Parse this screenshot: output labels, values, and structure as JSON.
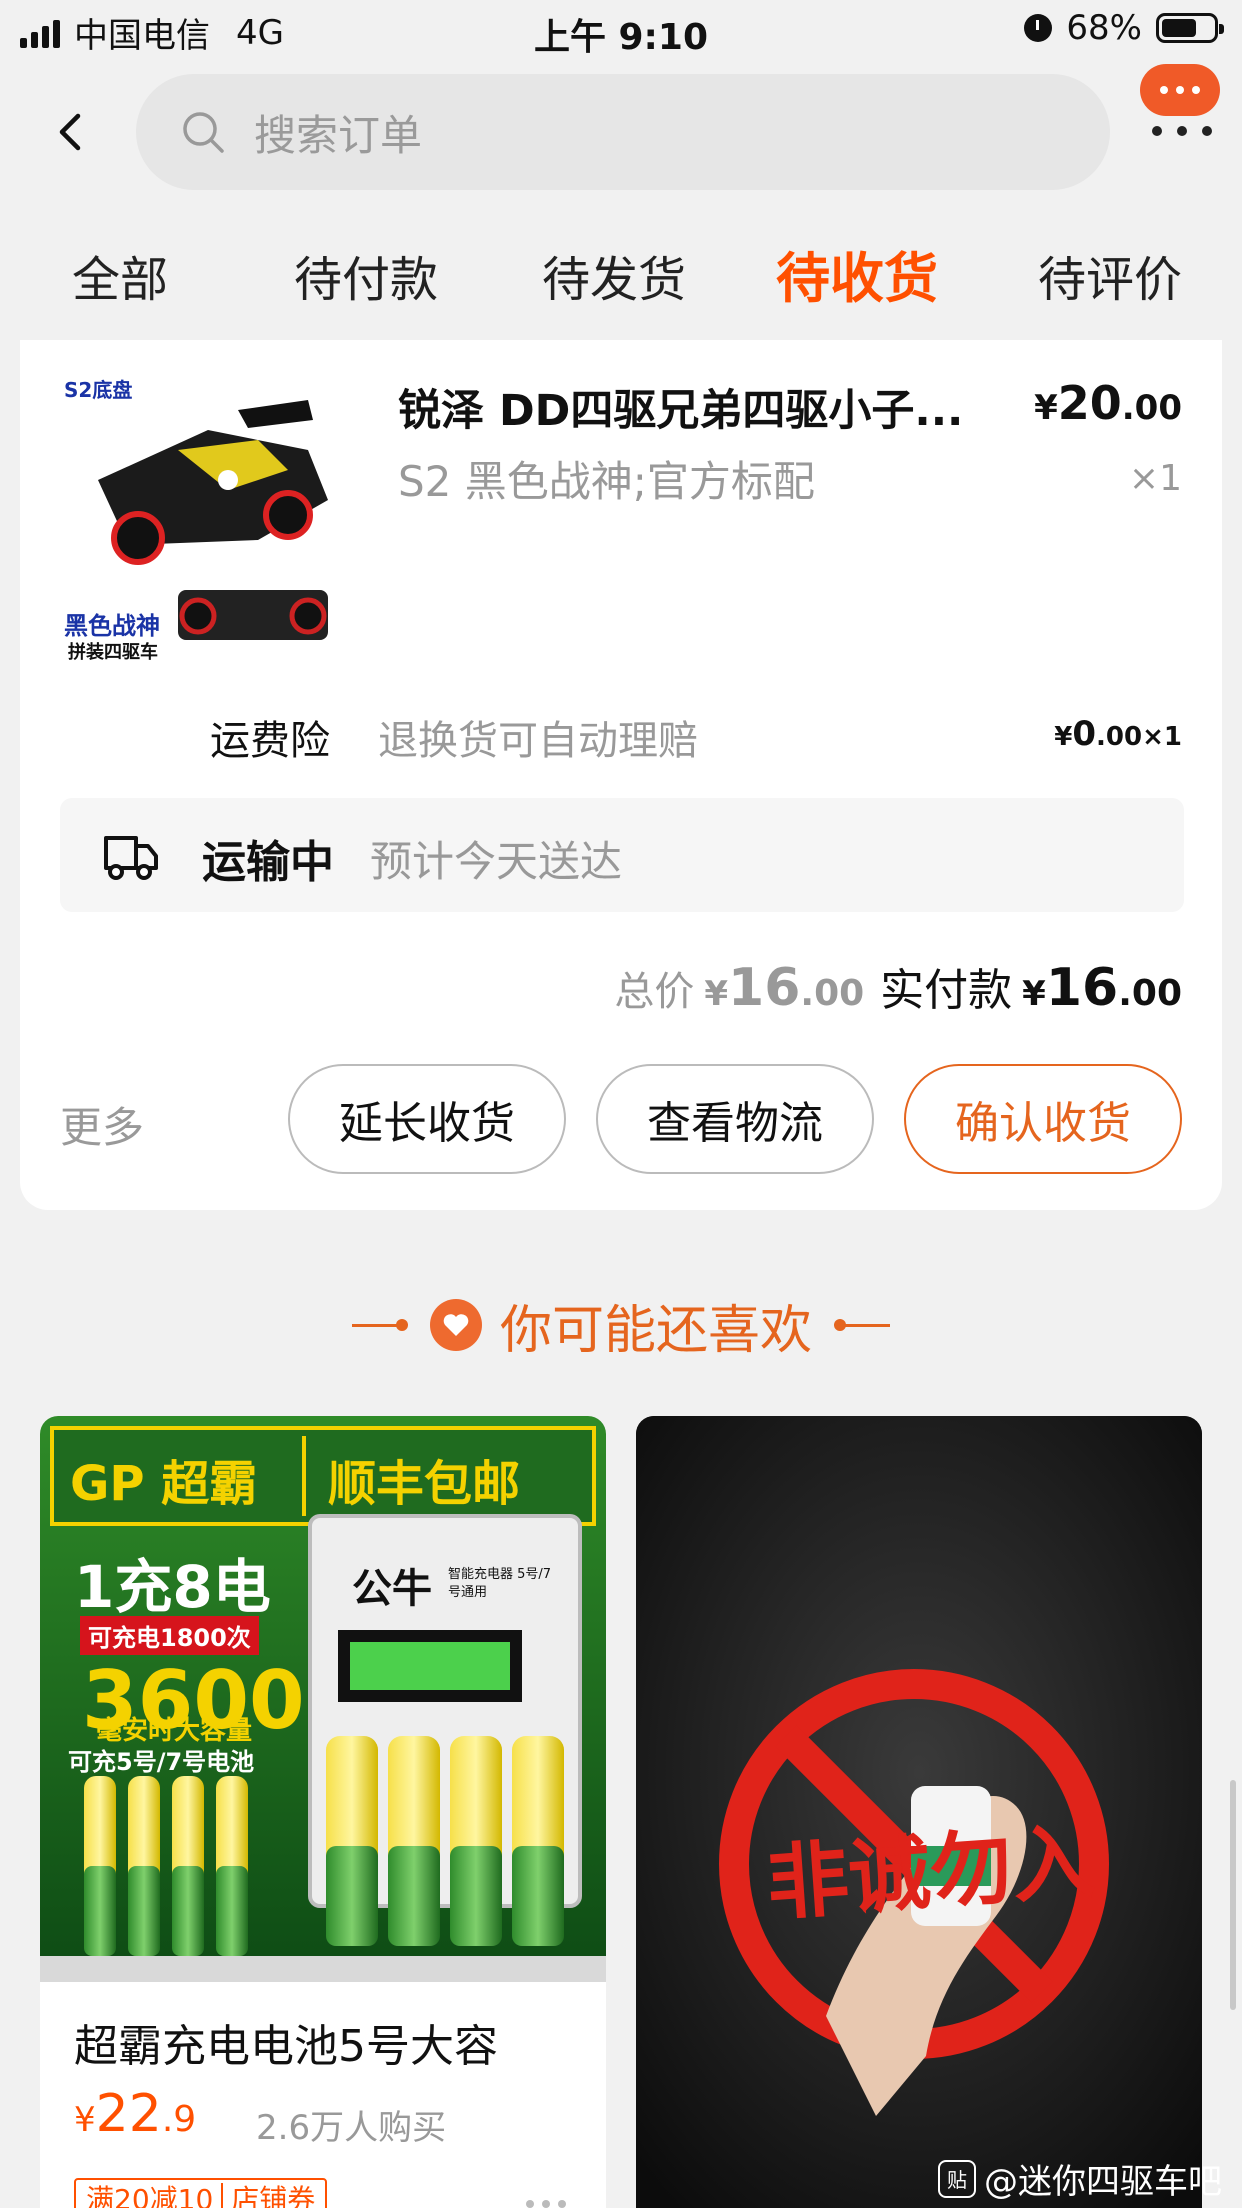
{
  "status_bar": {
    "carrier": "中国电信",
    "network": "4G",
    "time": "上午 9:10",
    "battery_pct": "68%",
    "battery_level": 0.68
  },
  "header": {
    "search_placeholder": "搜索订单"
  },
  "tabs": [
    {
      "label": "全部",
      "active": false
    },
    {
      "label": "待付款",
      "active": false
    },
    {
      "label": "待发货",
      "active": false
    },
    {
      "label": "待收货",
      "active": true
    },
    {
      "label": "待评价",
      "active": false
    }
  ],
  "order": {
    "thumb": {
      "badge": "S2底盘",
      "caption_title": "黑色战神",
      "caption_sub": "拼装四驱车"
    },
    "product_title": "锐泽 DD四驱兄弟四驱小子...",
    "sku": "S2 黑色战神;官方标配",
    "price_symbol": "¥",
    "price_int": "20",
    "price_dec": ".00",
    "qty": "×1",
    "insurance": {
      "label": "运费险",
      "desc": "退换货可自动理赔",
      "price_int": "0",
      "price_dec": ".00",
      "qty": "×1"
    },
    "logistics": {
      "status": "运输中",
      "eta": "预计今天送达"
    },
    "total": {
      "label": "总价",
      "int": "16",
      "dec": ".00",
      "paid_label": "实付款",
      "paid_int": "16",
      "paid_dec": ".00"
    },
    "actions": {
      "more": "更多",
      "extend": "延长收货",
      "track": "查看物流",
      "confirm": "确认收货"
    }
  },
  "recommend": {
    "title": "你可能还喜欢",
    "items": [
      {
        "name": "超霸充电电池5号大容",
        "price_int": "22",
        "price_dec": ".9",
        "sold": "2.6万人购买",
        "coupon_a": "满20减10",
        "coupon_b": "店铺券",
        "img_brand": "GP 超霸",
        "img_ship": "顺丰包邮",
        "img_line1": "1充8电",
        "img_line2": "可充电1800次",
        "img_line3": "3600",
        "img_line4": "毫安时大容量",
        "img_line5": "可充5号/7号电池",
        "img_charger": "公牛",
        "img_charger_sub": "智能充电器 5号/7号通用",
        "img_cell": "3600"
      },
      {
        "img_text": "非诚勿入"
      }
    ]
  },
  "watermark": "@迷你四驱车吧",
  "colors": {
    "accent": "#ff5000",
    "button_accent": "#e5651e",
    "bg": "#f1f1f1"
  }
}
